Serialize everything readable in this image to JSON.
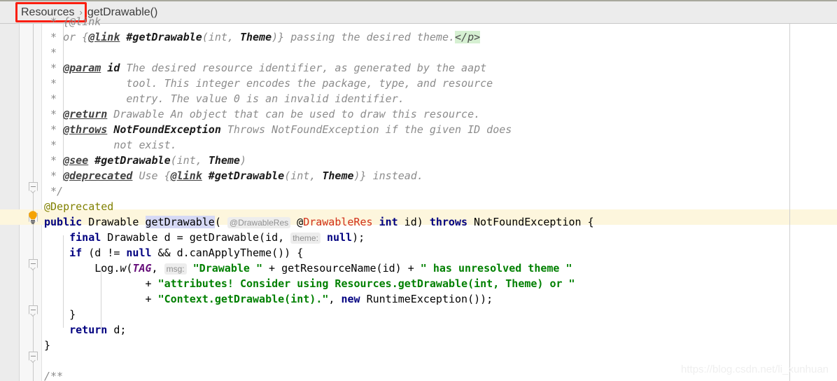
{
  "breadcrumb": {
    "items": [
      {
        "label": "Resources",
        "highlighted": true
      },
      {
        "label": "getDrawable()",
        "highlighted": false
      }
    ],
    "separator": "›",
    "highlight_color": "#fa1e0e"
  },
  "editor": {
    "language": "java",
    "gutter": {
      "lightbulb_icon": "lightbulb-icon",
      "fold_icon": "fold-collapse-icon"
    },
    "current_line_highlight_color": "#fdf6dd",
    "right_margin_column_guide": true,
    "lines": [
      {
        "n": 0,
        "text": ""
      },
      {
        "n": 1,
        "text": " * or {@link #getDrawable(int, Theme)} passing the desired theme.</p>"
      },
      {
        "n": 2,
        "text": " *"
      },
      {
        "n": 3,
        "text": " * @param id The desired resource identifier, as generated by the aapt"
      },
      {
        "n": 4,
        "text": " *           tool. This integer encodes the package, type, and resource"
      },
      {
        "n": 5,
        "text": " *           entry. The value 0 is an invalid identifier."
      },
      {
        "n": 6,
        "text": " * @return Drawable An object that can be used to draw this resource."
      },
      {
        "n": 7,
        "text": " * @throws NotFoundException Throws NotFoundException if the given ID does"
      },
      {
        "n": 8,
        "text": " *         not exist."
      },
      {
        "n": 9,
        "text": " * @see #getDrawable(int, Theme)"
      },
      {
        "n": 10,
        "text": " * @deprecated Use {@link #getDrawable(int, Theme)} instead."
      },
      {
        "n": 11,
        "text": " */"
      },
      {
        "n": 12,
        "text": "@Deprecated"
      },
      {
        "n": 13,
        "text": "public Drawable getDrawable( @DrawableRes @DrawableRes int id) throws NotFoundException {"
      },
      {
        "n": 14,
        "text": "    final Drawable d = getDrawable(id, theme: null);"
      },
      {
        "n": 15,
        "text": "    if (d != null && d.canApplyTheme()) {"
      },
      {
        "n": 16,
        "text": "        Log.w(TAG, msg: \"Drawable \" + getResourceName(id) + \" has unresolved theme \""
      },
      {
        "n": 17,
        "text": "                + \"attributes! Consider using Resources.getDrawable(int, Theme) or \""
      },
      {
        "n": 18,
        "text": "                + \"Context.getDrawable(int).\", new RuntimeException());"
      },
      {
        "n": 19,
        "text": "    }"
      },
      {
        "n": 20,
        "text": "    return d;"
      },
      {
        "n": 21,
        "text": "}"
      },
      {
        "n": 22,
        "text": ""
      },
      {
        "n": 23,
        "text": "/**"
      }
    ],
    "inlay_hints": [
      "theme:",
      "msg:"
    ],
    "annotations": [
      "@Deprecated",
      "@DrawableRes"
    ],
    "strings": [
      "\"Drawable \"",
      "\" has unresolved theme \"",
      "\"attributes! Consider using Resources.getDrawable(int, Theme) or \"",
      "\"Context.getDrawable(int).\""
    ],
    "colors": {
      "keyword": "#000080",
      "string": "#008000",
      "comment": "#8c8c8c",
      "annotation": "#808000",
      "annotation_red": "#d1301a",
      "static_field": "#660e7a",
      "selection": "#d6d9f5",
      "doc_tag_highlight": "#d6f0d2"
    }
  },
  "watermark": {
    "text": "https://blog.csdn.net/li_xunhuan"
  }
}
